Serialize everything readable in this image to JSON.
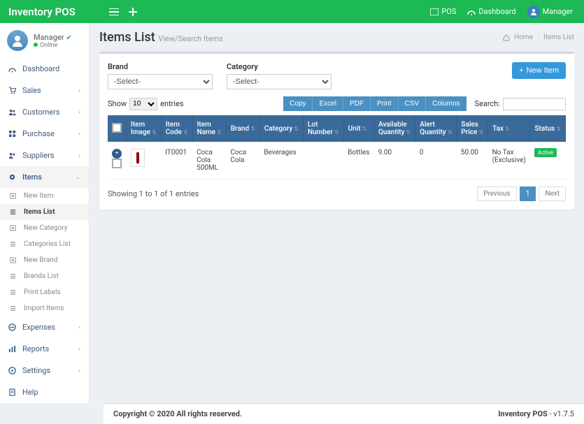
{
  "brand": "Inventory POS",
  "topnav": {
    "pos": "POS",
    "dashboard": "Dashboard",
    "user": "Manager"
  },
  "user_panel": {
    "name": "Manager",
    "status": "Online"
  },
  "sidebar": [
    {
      "icon": "dashboard",
      "label": "Dashboard",
      "caret": false
    },
    {
      "icon": "cart",
      "label": "Sales",
      "caret": true
    },
    {
      "icon": "users",
      "label": "Customers",
      "caret": true
    },
    {
      "icon": "purchase",
      "label": "Purchase",
      "caret": true
    },
    {
      "icon": "truck",
      "label": "Suppliers",
      "caret": true
    },
    {
      "icon": "items",
      "label": "Items",
      "caret": true,
      "active": true,
      "children": [
        {
          "label": "New Item"
        },
        {
          "label": "Items List",
          "active": true
        },
        {
          "label": "New Category"
        },
        {
          "label": "Categories List"
        },
        {
          "label": "New Brand"
        },
        {
          "label": "Brands List"
        },
        {
          "label": "Print Labels"
        },
        {
          "label": "Import Items"
        }
      ]
    },
    {
      "icon": "minus-circle",
      "label": "Expenses",
      "caret": true
    },
    {
      "icon": "chart",
      "label": "Reports",
      "caret": true
    },
    {
      "icon": "gear",
      "label": "Settings",
      "caret": true
    },
    {
      "icon": "book",
      "label": "Help",
      "caret": false
    }
  ],
  "header": {
    "title": "Items List",
    "subtitle": "View/Search Items",
    "breadcrumb": {
      "home": "Home",
      "current": "Items List"
    }
  },
  "filters": {
    "brand_label": "Brand",
    "brand_placeholder": "-Select-",
    "category_label": "Category",
    "category_placeholder": "-Select-",
    "new_item_btn": "New Item"
  },
  "list_controls": {
    "show": "Show",
    "entries": "entries",
    "length": "10",
    "search_label": "Search:",
    "buttons": [
      "Copy",
      "Excel",
      "PDF",
      "Print",
      "CSV",
      "Columns"
    ]
  },
  "columns": [
    "",
    "Item Image",
    "Item Code",
    "Item Name",
    "Brand",
    "Category",
    "Lot Number",
    "Unit",
    "Available Quantity",
    "Alert Quantity",
    "Sales Price",
    "Tax",
    "Status"
  ],
  "rows": [
    {
      "code": "IT0001",
      "name": "Coca Cola 500ML",
      "brand": "Coca Cola",
      "category": "Beverages",
      "lot": "",
      "unit": "Bottles",
      "avail": "9.00",
      "alert": "0",
      "price": "50.00",
      "tax": "No Tax (Exclusive)",
      "status": "Active"
    }
  ],
  "table_footer": {
    "info": "Showing 1 to 1 of 1 entries",
    "prev": "Previous",
    "page": "1",
    "next": "Next"
  },
  "footer": {
    "left": "Copyright © 2020 All rights reserved.",
    "right_name": "Inventory POS",
    "right_ver": " - v1.7.5"
  }
}
